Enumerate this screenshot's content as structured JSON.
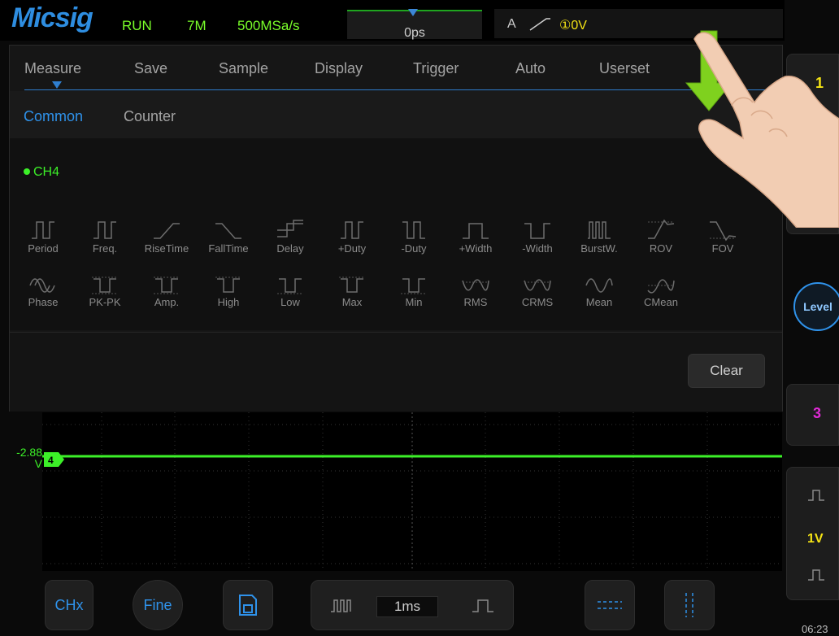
{
  "topbar": {
    "logo": "Micsig",
    "run_state": "RUN",
    "memory_depth": "7M",
    "sample_rate": "500MSa/s",
    "time_offset": "0ps",
    "trigger_source_label": "A",
    "trigger_level": "①0V"
  },
  "menu": {
    "tabs": [
      "Measure",
      "Save",
      "Sample",
      "Display",
      "Trigger",
      "Auto",
      "Userset"
    ],
    "active_tab": "Measure",
    "subtabs": [
      "Common",
      "Counter"
    ],
    "active_subtab": "Common",
    "channel": "CH4",
    "row1": [
      "Period",
      "Freq.",
      "RiseTime",
      "FallTime",
      "Delay",
      "+Duty",
      "-Duty",
      "+Width",
      "-Width",
      "BurstW.",
      "ROV",
      "FOV"
    ],
    "row2": [
      "Phase",
      "PK-PK",
      "Amp.",
      "High",
      "Low",
      "Max",
      "Min",
      "RMS",
      "CRMS",
      "Mean",
      "CMean"
    ],
    "clear_label": "Clear"
  },
  "waveform": {
    "channel_marker": "4",
    "offset_value": "-2.88",
    "offset_unit": "V",
    "trace_color": "#3cf028"
  },
  "right_rail": {
    "ch1_label": "1",
    "level_label": "Level",
    "ch3_label": "3",
    "scale": "1V",
    "clock": "06:23"
  },
  "bottombar": {
    "chx_label": "CHx",
    "fine_label": "Fine",
    "timebase": "1ms"
  },
  "colors": {
    "accent_blue": "#2f92ea",
    "ch4_green": "#3cf028",
    "ch1_yellow": "#f5e414",
    "ch3_magenta": "#e02ad6"
  },
  "icons": [
    "save-icon",
    "pulse-train-icon",
    "single-pulse-icon",
    "cursor-horizontal-icon",
    "cursor-vertical-icon",
    "swipe-down-arrow-icon",
    "hand-gesture-icon"
  ]
}
